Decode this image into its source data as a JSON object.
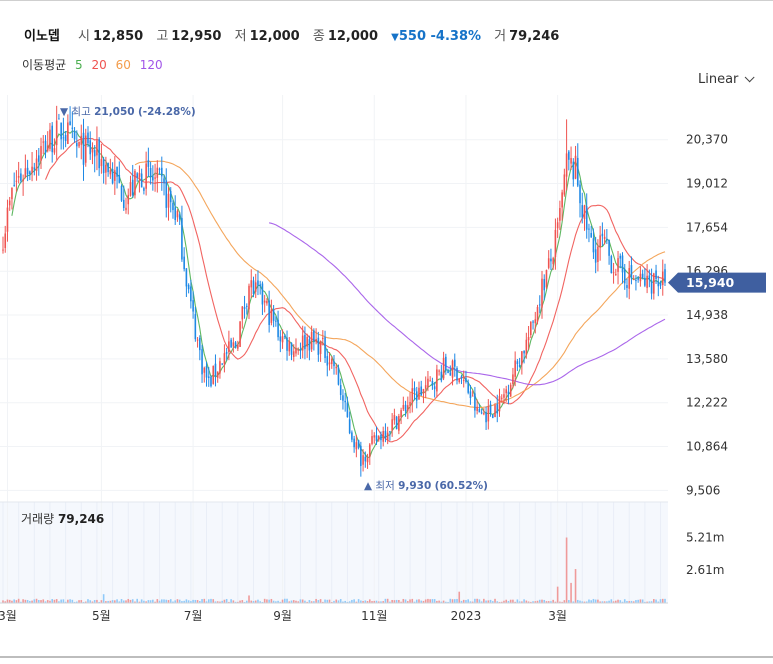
{
  "header": {
    "name": "이노뎁",
    "open_label": "시",
    "open": "12,850",
    "high_label": "고",
    "high": "12,950",
    "low_label": "저",
    "low": "12,000",
    "close_label": "종",
    "close": "12,000",
    "change_arrow": "▼",
    "change": "550",
    "change_pct": "-4.38%",
    "volume_label": "거",
    "volume": "79,246",
    "down_color": "#1673c8"
  },
  "ma_legend": {
    "title": "이동평균",
    "items": [
      {
        "label": "5",
        "color": "#4caf50"
      },
      {
        "label": "20",
        "color": "#ef5350"
      },
      {
        "label": "60",
        "color": "#f39c4a"
      },
      {
        "label": "120",
        "color": "#a155e8"
      }
    ]
  },
  "scale_toggle": "Linear",
  "volume_panel": {
    "label": "거래량",
    "value": "79,246"
  },
  "chart_data": {
    "type": "candlestick",
    "price_axis_ticks": [
      "20,370",
      "19,012",
      "17,654",
      "16,296",
      "14,938",
      "13,580",
      "12,222",
      "10,864",
      "9,506"
    ],
    "price_ylim": [
      9300,
      21600
    ],
    "current_price": "15,940",
    "current_price_value": 15940,
    "high_marker": {
      "label": "▼ 최고",
      "value": "21,050",
      "pct": "(-24.28%)",
      "price": 21050
    },
    "low_marker": {
      "label": "▲ 최저",
      "value": "9,930",
      "pct": "(60.52%)",
      "price": 9930
    },
    "volume_axis_ticks": [
      "5.21m",
      "2.61m"
    ],
    "volume_ylim": [
      0,
      7000000
    ],
    "x_ticks": [
      "3월",
      "5월",
      "7월",
      "9월",
      "11월",
      "2023",
      "3월"
    ],
    "x_tick_index": [
      2,
      44,
      85,
      125,
      166,
      207,
      248
    ],
    "up_color": "#ef5350",
    "down_color": "#1e88e5",
    "anchors": [
      [
        0,
        17400
      ],
      [
        5,
        19000
      ],
      [
        12,
        19600
      ],
      [
        20,
        20300
      ],
      [
        27,
        20700
      ],
      [
        33,
        20100
      ],
      [
        40,
        20000
      ],
      [
        47,
        19500
      ],
      [
        55,
        18600
      ],
      [
        62,
        19300
      ],
      [
        70,
        19000
      ],
      [
        78,
        18000
      ],
      [
        84,
        15200
      ],
      [
        89,
        13400
      ],
      [
        92,
        12800
      ],
      [
        98,
        13600
      ],
      [
        104,
        14000
      ],
      [
        110,
        15900
      ],
      [
        116,
        15400
      ],
      [
        124,
        14300
      ],
      [
        130,
        13900
      ],
      [
        136,
        14200
      ],
      [
        142,
        14000
      ],
      [
        148,
        13400
      ],
      [
        155,
        11400
      ],
      [
        160,
        10500
      ],
      [
        166,
        11000
      ],
      [
        171,
        11400
      ],
      [
        176,
        11700
      ],
      [
        183,
        12400
      ],
      [
        190,
        12700
      ],
      [
        197,
        13300
      ],
      [
        203,
        13200
      ],
      [
        208,
        12600
      ],
      [
        212,
        11900
      ],
      [
        217,
        11900
      ],
      [
        223,
        12300
      ],
      [
        229,
        13300
      ],
      [
        236,
        14400
      ],
      [
        240,
        15600
      ],
      [
        245,
        16600
      ],
      [
        248,
        17500
      ],
      [
        252,
        19600
      ],
      [
        256,
        19400
      ],
      [
        260,
        17900
      ],
      [
        264,
        16900
      ],
      [
        268,
        17200
      ],
      [
        272,
        16600
      ],
      [
        276,
        16300
      ],
      [
        280,
        16100
      ],
      [
        284,
        16000
      ],
      [
        288,
        15900
      ],
      [
        292,
        16100
      ],
      [
        296,
        15940
      ]
    ],
    "volume_spikes": [
      [
        252,
        5210000
      ],
      [
        256,
        2700000
      ],
      [
        248,
        1300000
      ],
      [
        254,
        1600000
      ],
      [
        204,
        900000
      ],
      [
        45,
        700000
      ],
      [
        110,
        600000
      ]
    ]
  }
}
